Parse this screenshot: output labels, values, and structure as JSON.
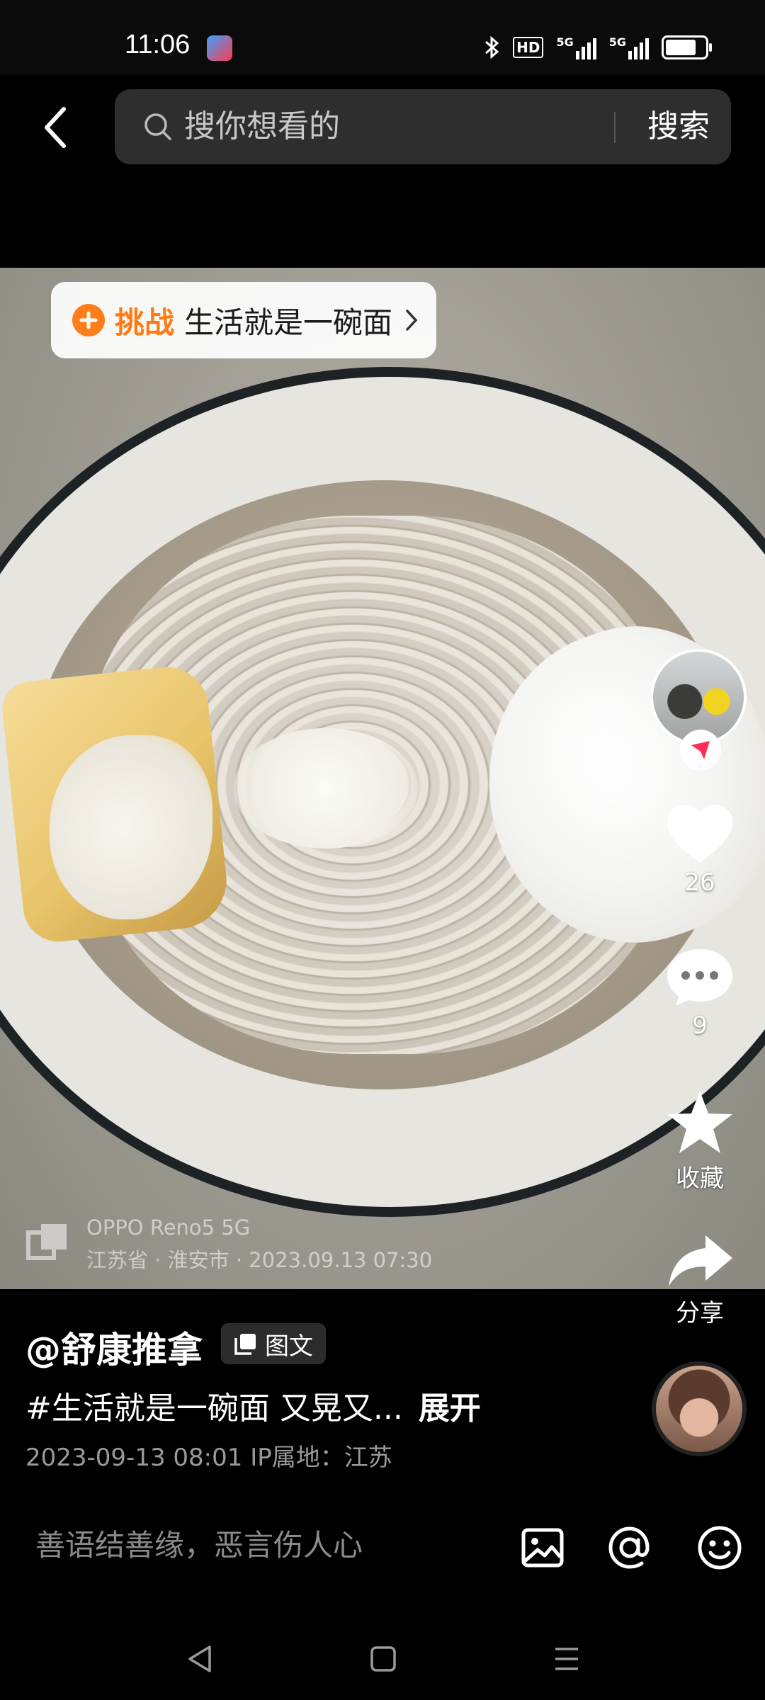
{
  "status_bar": {
    "time": "11:06",
    "hd_label": "HD",
    "net1": "5G",
    "net2": "5G",
    "battery_percent": 80
  },
  "search": {
    "placeholder": "搜你想看的",
    "button_label": "搜索"
  },
  "challenge": {
    "label": "挑战",
    "title": "生活就是一碗面"
  },
  "watermark": {
    "device": "OPPO Reno5 5G",
    "location_time": "江苏省 · 淮安市 · 2023.09.13 07:30"
  },
  "actions": {
    "likes": "26",
    "comments": "9",
    "favorite_label": "收藏",
    "share_label": "分享"
  },
  "post": {
    "author": "@舒康推拿",
    "type_badge": "图文",
    "caption": "#生活就是一碗面 又晃又...",
    "expand": "展开",
    "meta": "2023-09-13 08:01  IP属地：江苏"
  },
  "comment_bar": {
    "placeholder": "善语结善缘，恶言伤人心"
  },
  "icons": [
    "back-arrow-icon",
    "search-icon",
    "challenge-icon",
    "chevron-right-icon",
    "heart-icon",
    "comment-icon",
    "star-icon",
    "share-icon",
    "image-icon",
    "at-icon",
    "emoji-icon",
    "nav-back-icon",
    "nav-home-icon",
    "nav-menu-icon"
  ],
  "colors": {
    "accent": "#ff7a12",
    "background": "#000000",
    "search_bg": "#2e2e2e"
  }
}
